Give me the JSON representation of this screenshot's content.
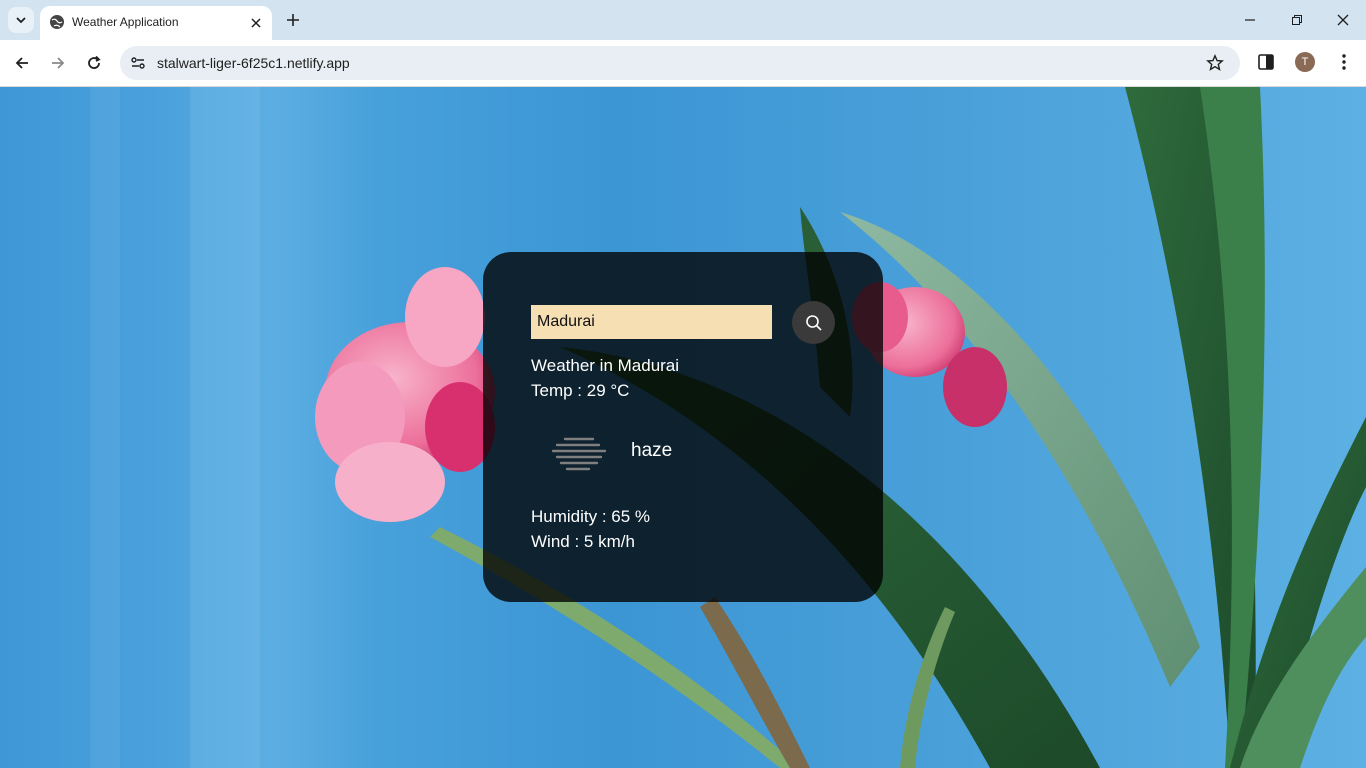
{
  "browser": {
    "tab_title": "Weather Application",
    "url": "stalwart-liger-6f25c1.netlify.app",
    "profile_initial": "T"
  },
  "weather": {
    "search_value": "Madurai",
    "city_text": "Weather in Madurai",
    "temp_text": "Temp : 29 °C",
    "description": "haze",
    "humidity_text": "Humidity : 65 %",
    "wind_text": "Wind : 5 km/h"
  },
  "colors": {
    "tabbar": "#d3e3f0",
    "card_background": "rgba(0,0,0,0.78)",
    "input_background": "#f5dfb3",
    "sky": "#3f97d6"
  },
  "icons": {
    "tab_search": "chevron-down-icon",
    "favicon": "globe-icon",
    "search": "magnifier-icon",
    "weather": "haze-icon"
  }
}
